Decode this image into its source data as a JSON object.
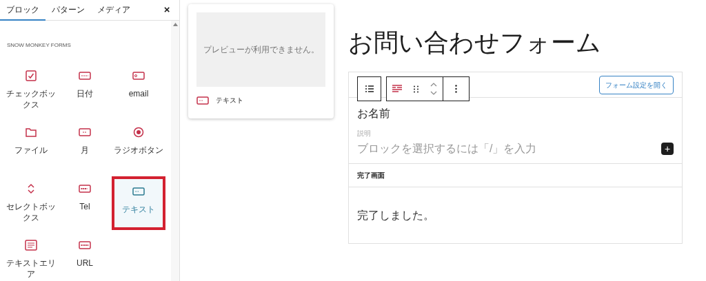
{
  "sidebar": {
    "tabs": [
      {
        "label": "ブロック",
        "selected": true
      },
      {
        "label": "パターン",
        "selected": false
      },
      {
        "label": "メディア",
        "selected": false
      }
    ],
    "close": "×",
    "category": "SNOW MONKEY FORMS",
    "blocks": [
      {
        "label": "チェックボックス",
        "kind": "checkbox",
        "selected": false
      },
      {
        "label": "日付",
        "kind": "date",
        "selected": false
      },
      {
        "label": "email",
        "kind": "email",
        "selected": false
      },
      {
        "label": "ファイル",
        "kind": "file",
        "selected": false
      },
      {
        "label": "月",
        "kind": "month",
        "selected": false
      },
      {
        "label": "ラジオボタン",
        "kind": "radio",
        "selected": false
      },
      {
        "label": "セレクトボックス",
        "kind": "select",
        "selected": false
      },
      {
        "label": "Tel",
        "kind": "tel",
        "selected": false
      },
      {
        "label": "テキスト",
        "kind": "text",
        "selected": true
      },
      {
        "label": "テキストエリア",
        "kind": "textarea",
        "selected": false
      },
      {
        "label": "URL",
        "kind": "url",
        "selected": false
      }
    ]
  },
  "preview": {
    "message": "プレビューが利用できません。",
    "block": "テキスト"
  },
  "editor": {
    "title": "お問い合わせフォーム",
    "settings_button": "フォーム設定を開く",
    "field_label": "お名前",
    "field_description": "説明",
    "placeholder": "ブロックを選択するには「/」を入力",
    "add_button": "+",
    "complete_heading": "完了画面",
    "complete_message": "完了しました。"
  }
}
